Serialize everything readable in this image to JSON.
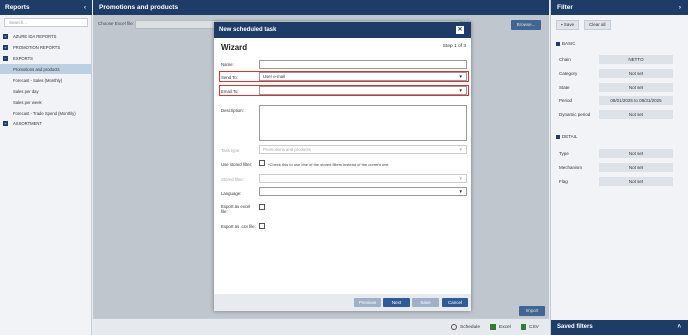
{
  "left": {
    "title": "Reports",
    "search_placeholder": "Search...",
    "tree": [
      {
        "label": "AZURE IDA REPORTS",
        "toggle": "+"
      },
      {
        "label": "PROMOTION REPORTS",
        "toggle": "+"
      },
      {
        "label": "EXPORTS",
        "toggle": "−"
      },
      {
        "label": "Promotions and products"
      },
      {
        "label": "Forecast - Sales (Monthly)"
      },
      {
        "label": "Sales per day"
      },
      {
        "label": "Sales per week"
      },
      {
        "label": "Forecast - Trade Spend (Monthly)"
      },
      {
        "label": "ASSORTMENT",
        "toggle": "+"
      }
    ]
  },
  "main": {
    "title": "Promotions and products",
    "excel_label": "Choose Excel file:",
    "browse": "Browse...",
    "import": "Import",
    "footer": {
      "schedule": "Schedule",
      "excel": "Excel",
      "csv": "CSV"
    }
  },
  "dialog": {
    "title": "New scheduled task",
    "heading": "Wizard",
    "step": "Step 1 of 3",
    "name_label": "Name:",
    "send_to_label": "Send To:",
    "send_to_value": "User e-mail",
    "email_to_label": "Email To:",
    "description_label": "Description:",
    "task_type_label": "Task type:",
    "task_type_value": "Promotions and products",
    "use_stored_label": "Use stored filter:",
    "use_stored_hint": "*Check this to use one of the stored filters instead of the current one.",
    "stored_filter_label": "Stored filter:",
    "language_label": "Language:",
    "export_excel_label": "Export as excel file:",
    "export_csv_label": "Export as .csv file:",
    "buttons": {
      "previous": "Previous",
      "next": "Next",
      "save": "Save",
      "cancel": "Cancel"
    },
    "colors": {
      "highlight": "#d33333",
      "primary": "#2f5c96"
    }
  },
  "filter": {
    "title": "Filter",
    "save": "Save",
    "clear_all": "Clear all",
    "basic_header": "BASIC",
    "basic": [
      {
        "label": "Chain",
        "value": "NETTO"
      },
      {
        "label": "Category",
        "value": "Not set"
      },
      {
        "label": "State",
        "value": "Not set"
      },
      {
        "label": "Period",
        "value": "08/01/2025 to 08/31/2025"
      },
      {
        "label": "Dynamic period",
        "value": "Not set"
      }
    ],
    "detail_header": "DETAIL",
    "detail": [
      {
        "label": "Type",
        "value": "Not set"
      },
      {
        "label": "Mechanism",
        "value": "Not set"
      },
      {
        "label": "Flag",
        "value": "Not set"
      }
    ],
    "saved_filters": "Saved filters"
  }
}
